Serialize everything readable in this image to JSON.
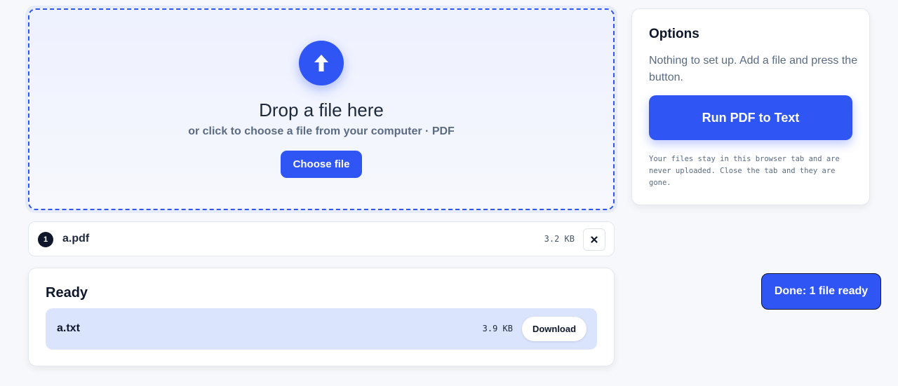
{
  "dropzone": {
    "title": "Drop a file here",
    "subtitle": "or click to choose a file from your computer · PDF",
    "choose_label": "Choose file",
    "icon": "upload-arrow-icon"
  },
  "files": [
    {
      "index": "1",
      "name": "a.pdf",
      "size": "3.2 KB",
      "remove_icon": "close-icon"
    }
  ],
  "ready": {
    "title": "Ready",
    "results": [
      {
        "name": "a.txt",
        "size": "3.9 KB",
        "download_label": "Download"
      }
    ]
  },
  "options": {
    "title": "Options",
    "description": "Nothing to set up. Add a file and press the button.",
    "run_label": "Run PDF to Text",
    "privacy_note": "Your files stay in this browser tab and are never uploaded. Close the tab and they are gone."
  },
  "toast": {
    "message": "Done: 1 file ready"
  },
  "colors": {
    "accent": "#2f55f5",
    "ink": "#0f172a",
    "muted": "#5b6b82",
    "result_bg": "#dbe4fd"
  }
}
